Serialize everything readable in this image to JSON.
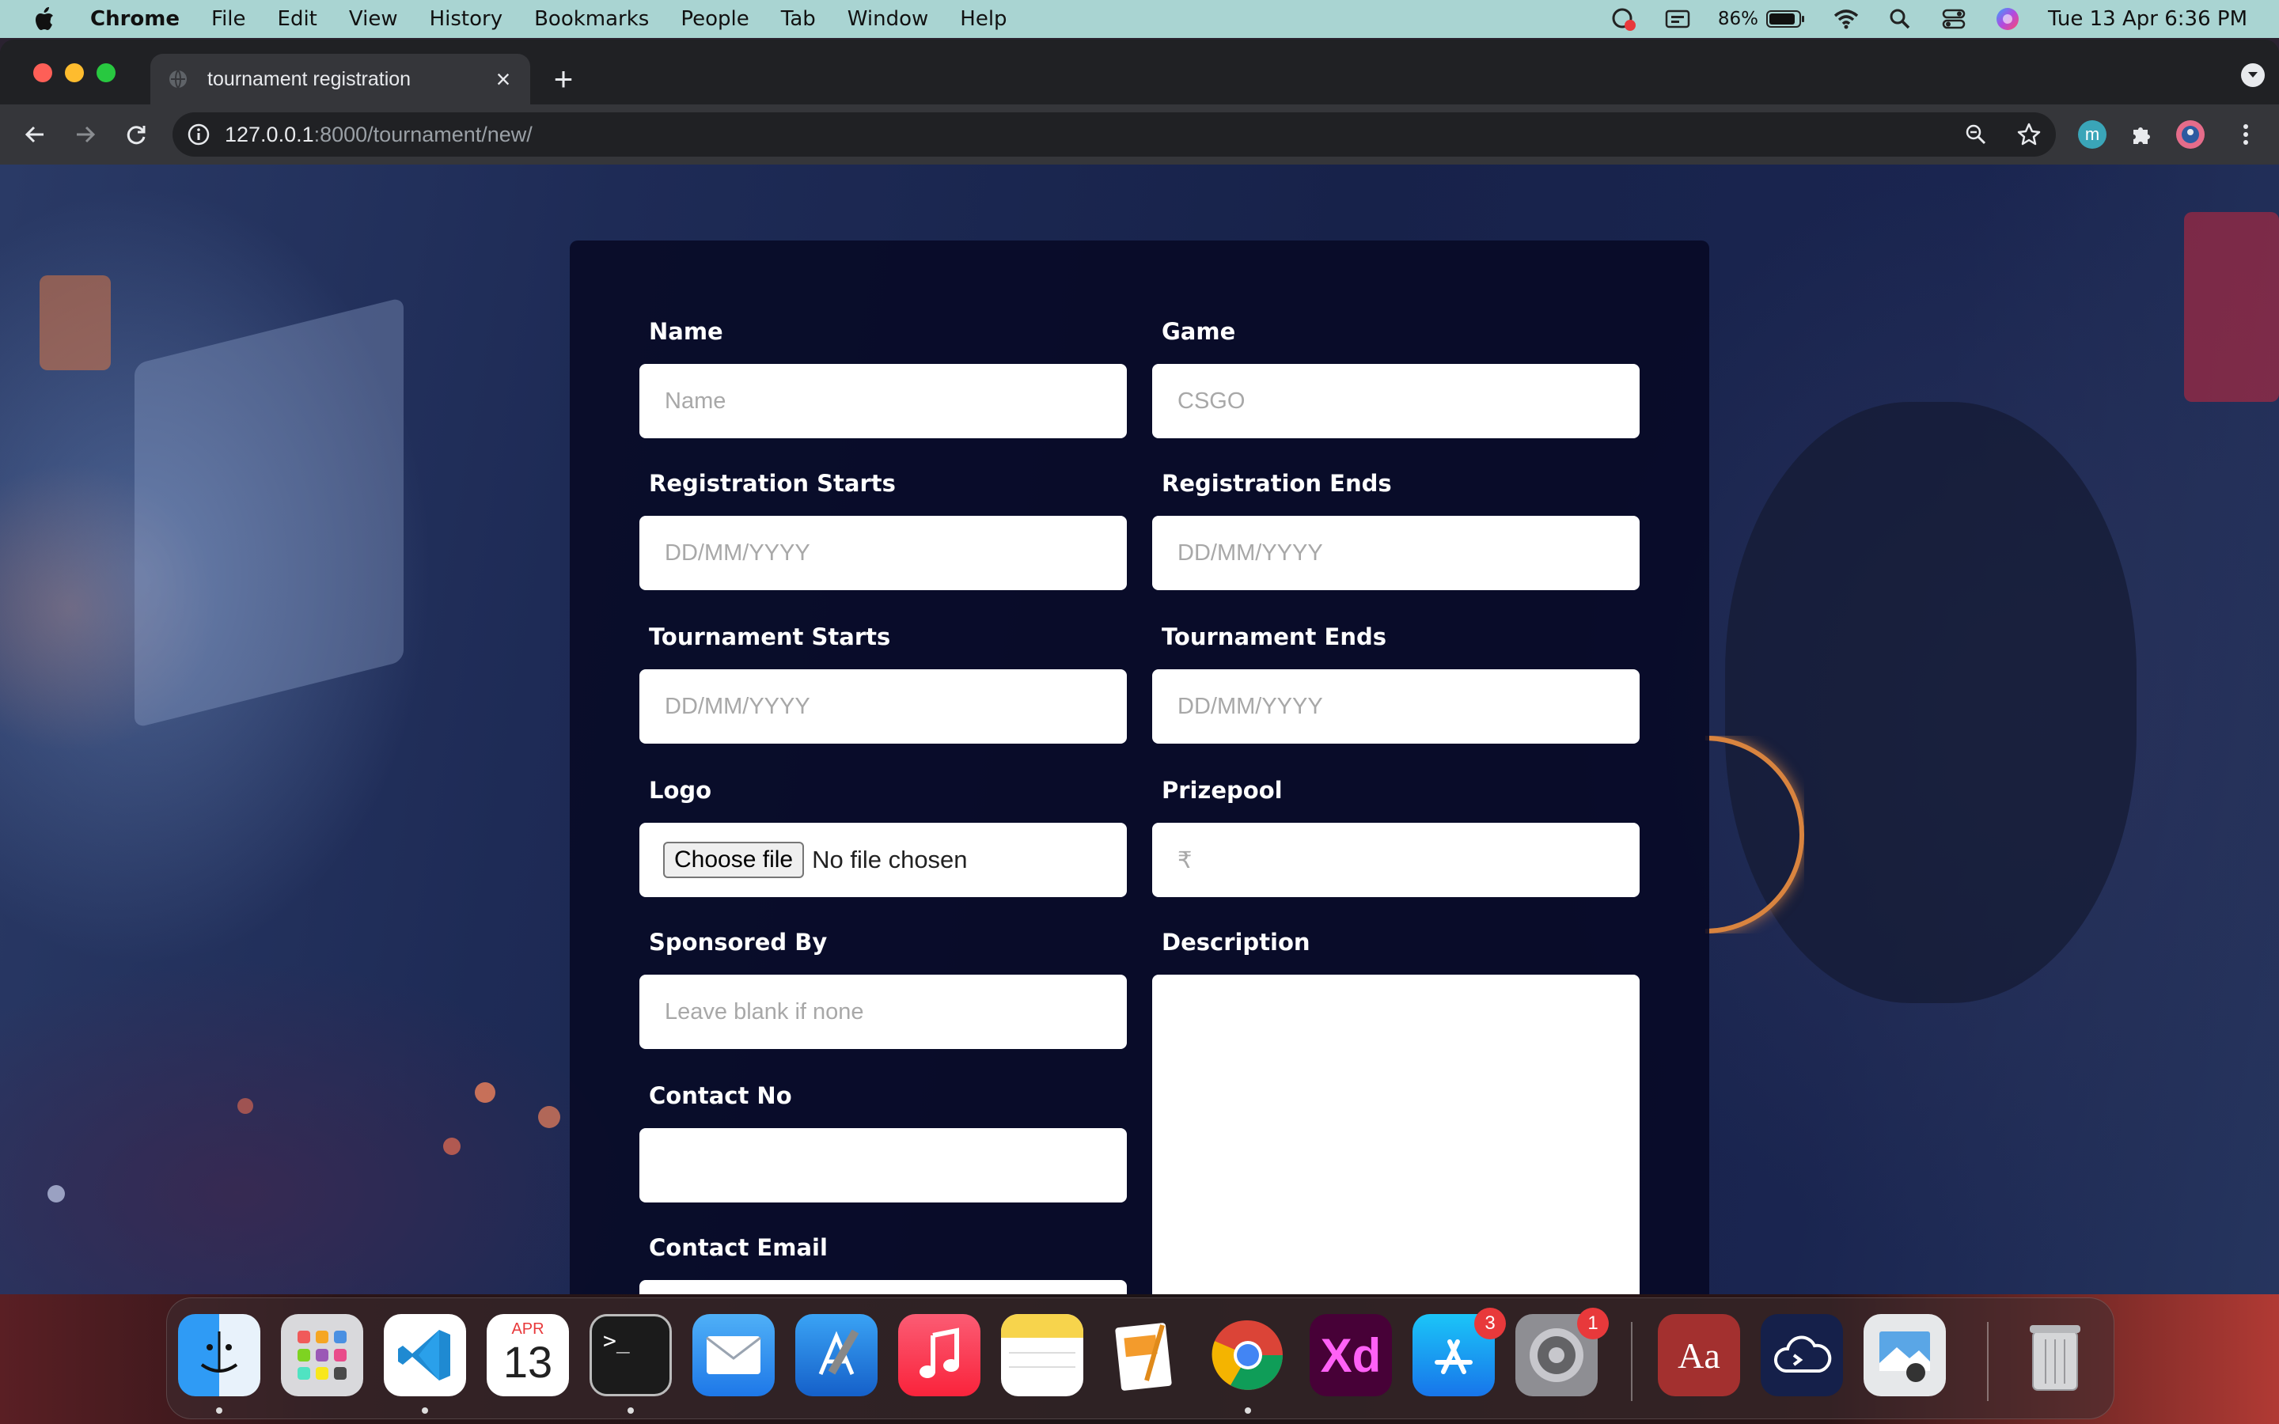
{
  "menubar": {
    "app": "Chrome",
    "items": [
      "File",
      "Edit",
      "View",
      "History",
      "Bookmarks",
      "People",
      "Tab",
      "Window",
      "Help"
    ],
    "battery": "86%",
    "datetime": "Tue 13 Apr  6:36 PM"
  },
  "browser": {
    "tab_title": "tournament registration",
    "url_host": "127.0.0.1",
    "url_rest": ":8000/tournament/new/",
    "profile_initial": "m"
  },
  "form": {
    "name": {
      "label": "Name",
      "placeholder": "Name"
    },
    "game": {
      "label": "Game",
      "placeholder": "CSGO"
    },
    "reg_start": {
      "label": "Registration Starts",
      "placeholder": "DD/MM/YYYY"
    },
    "reg_end": {
      "label": "Registration Ends",
      "placeholder": "DD/MM/YYYY"
    },
    "tour_start": {
      "label": "Tournament Starts",
      "placeholder": "DD/MM/YYYY"
    },
    "tour_end": {
      "label": "Tournament Ends",
      "placeholder": "DD/MM/YYYY"
    },
    "logo": {
      "label": "Logo",
      "button": "Choose file",
      "status": "No file chosen"
    },
    "prizepool": {
      "label": "Prizepool",
      "placeholder": "₹"
    },
    "sponsor": {
      "label": "Sponsored By",
      "placeholder": "Leave blank if none"
    },
    "description": {
      "label": "Description"
    },
    "contact_no": {
      "label": "Contact No"
    },
    "contact_email": {
      "label": "Contact Email"
    }
  },
  "dock": {
    "calendar_month": "APR",
    "calendar_day": "13",
    "appstore_badge": "3",
    "settings_badge": "1",
    "dictionary_label": "Aa",
    "terminal_prompt": ">_",
    "xd_label": "Xd"
  }
}
